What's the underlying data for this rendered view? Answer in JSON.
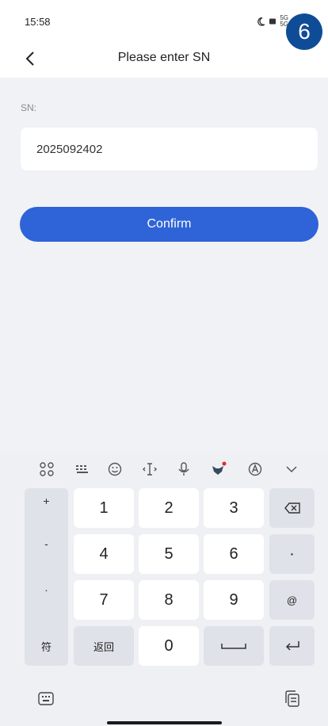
{
  "status": {
    "time": "15:58",
    "sig_top": "5G",
    "sig_bot": "5G"
  },
  "badge": "6",
  "appbar": {
    "title": "Please enter SN"
  },
  "form": {
    "label": "SN:",
    "value": "2025092402",
    "confirm": "Confirm"
  },
  "keyboard": {
    "symbols": [
      "+",
      "-",
      ".",
      "/"
    ],
    "digits": [
      "1",
      "2",
      "3",
      "4",
      "5",
      "6",
      "7",
      "8",
      "9",
      "0"
    ],
    "dot": "·",
    "at": "@",
    "fu": "符",
    "fanhui": "返回"
  },
  "colors": {
    "accent": "#2f63d8",
    "badge": "#0f4c97"
  },
  "icons": [
    "back-icon",
    "apps-grid-icon",
    "keyboard-layout-icon",
    "emoji-icon",
    "cursor-icon",
    "mic-icon",
    "mascot-icon",
    "translate-icon",
    "chevron-down-icon",
    "backspace-icon",
    "space-icon",
    "enter-icon",
    "keyboard-switch-icon",
    "clipboard-icon",
    "moon-icon",
    "battery-icon"
  ]
}
